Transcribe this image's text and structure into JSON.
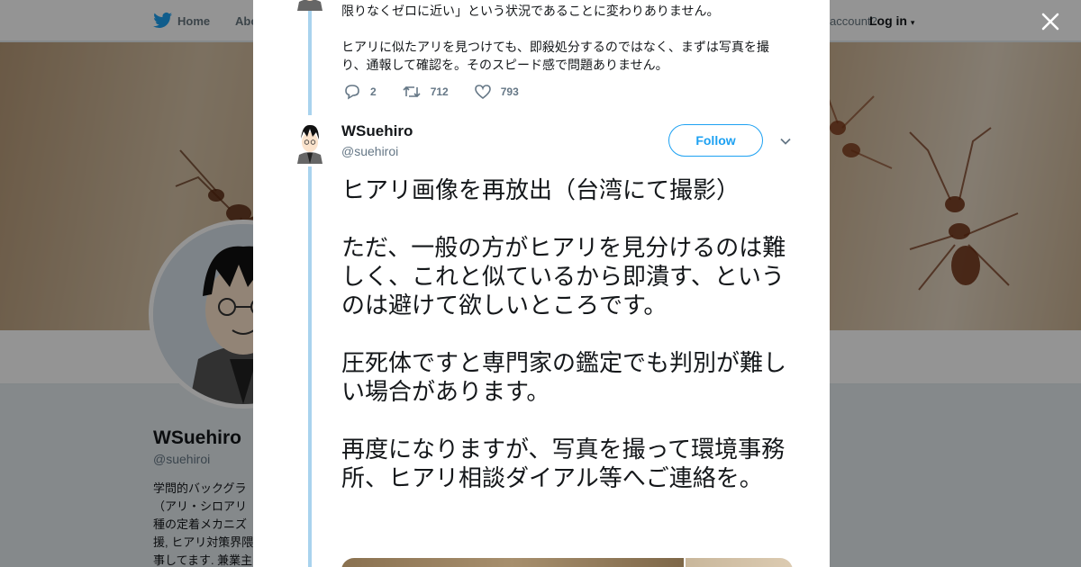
{
  "nav": {
    "home": "Home",
    "about": "Abo",
    "account_prompt": "account?",
    "login": "Log in"
  },
  "profile": {
    "name": "WSuehiro",
    "handle": "@suehiroi",
    "bio": [
      "学問的バックグラ",
      "（アリ・シロアリ",
      "種の定着メカニズ",
      "援, ヒアリ対策界隈",
      "事してます. 兼業主"
    ]
  },
  "previous_tweet": {
    "line1": "限りなくゼロに近い」という状況であることに変わりありません。",
    "line2": "ヒアリに似たアリを見つけても、即殺処分するのではなく、まずは写真を撮",
    "line3": "り、通報して確認を。そのスピード感で問題ありません。",
    "replies": "2",
    "retweets": "712",
    "likes": "793"
  },
  "tweet": {
    "author_name": "WSuehiro",
    "author_handle": "@suehiroi",
    "follow_label": "Follow",
    "paragraphs": [
      "ヒアリ画像を再放出（台湾にて撮影）",
      "ただ、一般の方がヒアリを見分けるのは難しく、これと似ているから即潰す、というのは避けて欲しいところです。",
      "圧死体ですと専門家の鑑定でも判別が難しい場合があります。",
      "再度になりますが、写真を撮って環境事務所、ヒアリ相談ダイアル等へご連絡を。"
    ]
  },
  "icons": {
    "brand": "twitter-bird-icon",
    "close": "close-icon",
    "reply": "reply-icon",
    "retweet": "retweet-icon",
    "like": "heart-icon",
    "more": "chevron-down-icon"
  },
  "colors": {
    "brand_blue": "#1da1f2",
    "thread_line": "#a9d3ee",
    "muted": "#657786"
  }
}
